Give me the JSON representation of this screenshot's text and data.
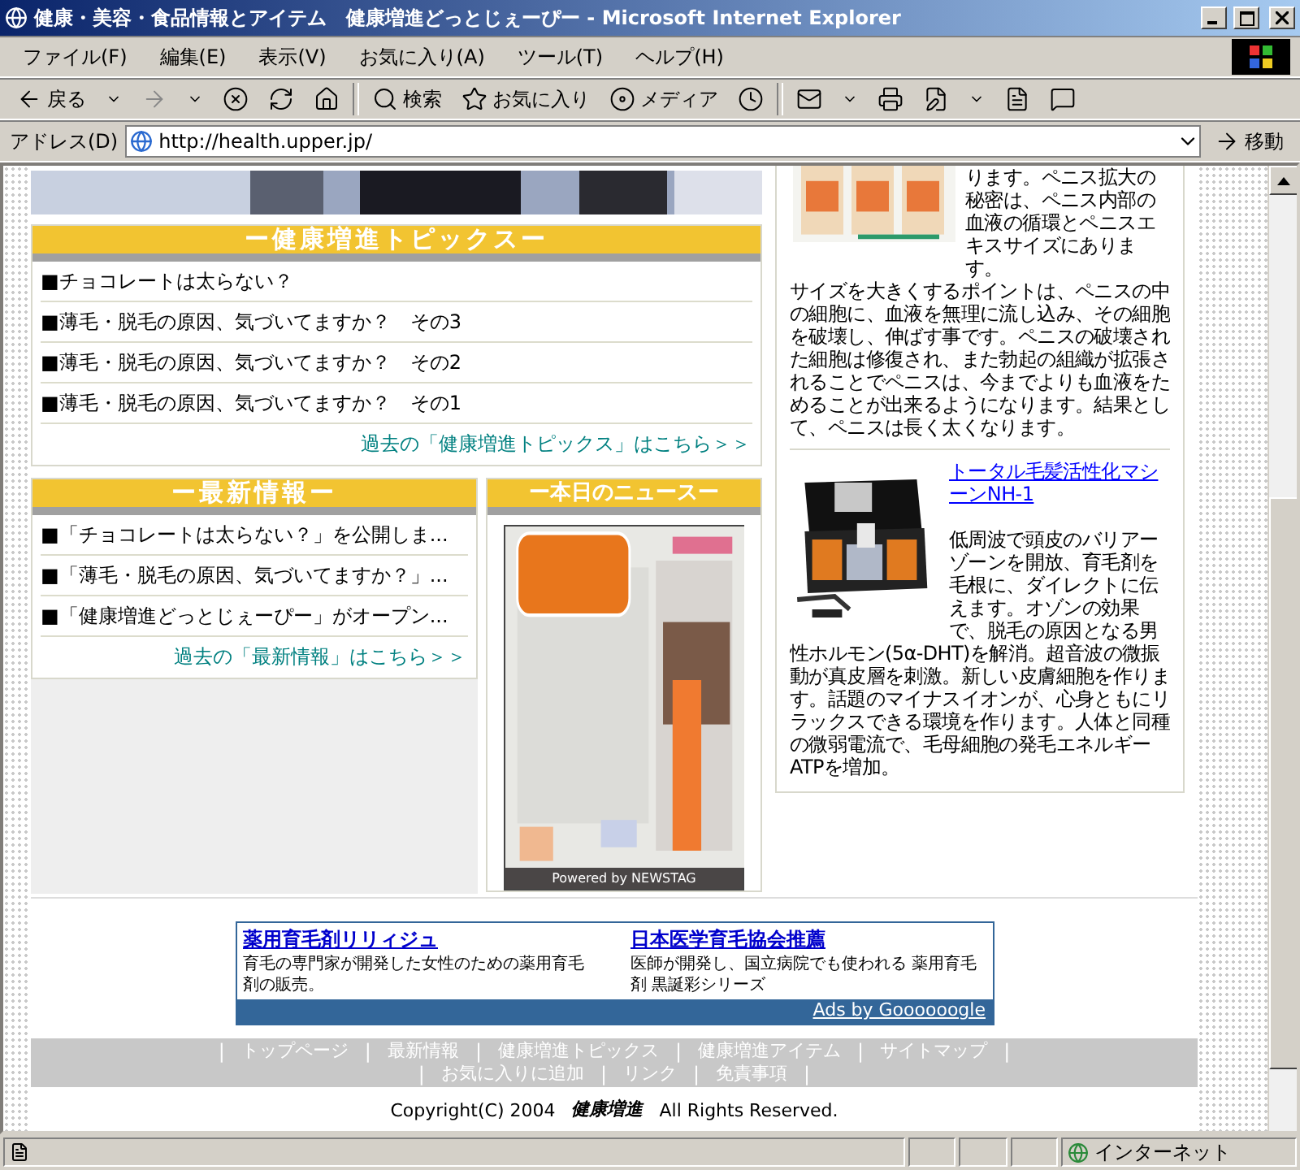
{
  "window": {
    "title": "健康・美容・食品情報とアイテム　健康増進どっとじぇーぴー - Microsoft Internet Explorer"
  },
  "menu": [
    "ファイル(F)",
    "編集(E)",
    "表示(V)",
    "お気に入り(A)",
    "ツール(T)",
    "ヘルプ(H)"
  ],
  "toolbar": {
    "back": "戻る",
    "search": "検索",
    "favorites": "お気に入り",
    "media": "メディア"
  },
  "address": {
    "label": "アドレス(D)",
    "url": "http://health.upper.jp/",
    "go": "移動"
  },
  "topics": {
    "heading": "ー健康増進トピックスー",
    "items": [
      "■チョコレートは太らない？",
      "■薄毛・脱毛の原因、気づいてますか？　その3",
      "■薄毛・脱毛の原因、気づいてますか？　その2",
      "■薄毛・脱毛の原因、気づいてますか？　その1"
    ],
    "more": "過去の「健康増進トピックス」はこちら＞＞"
  },
  "news_info": {
    "heading": "ー最新情報ー",
    "items": [
      "■「チョコレートは太らない？」を公開しま...",
      "■「薄毛・脱毛の原因、気づいてますか？」...",
      "■「健康増進どっとじぇーぴー」がオープン..."
    ],
    "more": "過去の「最新情報」はこちら＞＞"
  },
  "today_news": {
    "heading": "ー本日のニュースー",
    "credit": "Powered by NEWSTAG"
  },
  "products": [
    {
      "text": [
        "ります。ペニス拡大の秘密は、ペニス内部の血液の循環とペニスエキスサイズにあります。",
        "サイズを大きくするポイントは、ペニスの中の細胞に、血液を無理に流し込み、その細胞を破壊し、伸ばす事です。ペニスの破壊された細胞は修復され、また勃起の組織が拡張されることでペニスは、今までよりも血液をためることが出来るようになります。結果として、ペニスは長く太くなります。"
      ]
    },
    {
      "title": "トータル毛髪活性化マシーンNH-1",
      "text": [
        "低周波で頭皮のバリアーゾーンを開放、育毛剤を毛根に、ダイレクトに伝えます。オゾンの効果で、脱毛の原因となる男",
        "性ホルモン(5α-DHT)を解消。超音波の微振動が真皮層を刺激。新しい皮膚細胞を作ります。話題のマイナスイオンが、心身ともにリラックスできる環境を作ります。人体と同種の微弱電流で、毛母細胞の発毛エネルギーATPを増加。"
      ]
    }
  ],
  "ads": {
    "items": [
      {
        "title": "薬用育毛剤リリィジュ",
        "text": "育毛の専門家が開発した女性のための薬用育毛剤の販売。"
      },
      {
        "title": "日本医学育毛協会推薦",
        "text": "医師が開発し、国立病院でも使われる 薬用育毛剤 黒誕彩シリーズ"
      }
    ],
    "credit": "Ads by Goooooogle"
  },
  "footer_separator": "|",
  "footer_nav": [
    [
      "トップページ",
      "最新情報",
      "健康増進トピックス",
      "健康増進アイテム",
      "サイトマップ"
    ],
    [
      "お気に入りに追加",
      "リンク",
      "免責事項"
    ]
  ],
  "copyright": {
    "before": "Copyright(C) 2004",
    "logo": "健康増進",
    "after": "All Rights Reserved."
  },
  "status_bar": {
    "zone": "インターネット"
  }
}
